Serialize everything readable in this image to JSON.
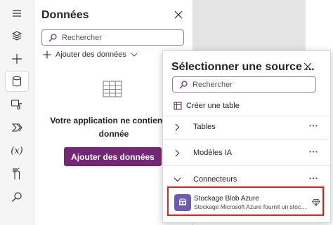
{
  "rail": {
    "items": [
      {
        "name": "hamburger-icon"
      },
      {
        "name": "layers-icon"
      },
      {
        "name": "plus-icon"
      },
      {
        "name": "database-icon",
        "active": true
      },
      {
        "name": "media-icon"
      },
      {
        "name": "power-automate-icon"
      },
      {
        "name": "variables-icon",
        "label": "(x)"
      },
      {
        "name": "tools-icon"
      },
      {
        "name": "search-icon"
      }
    ]
  },
  "data_pane": {
    "title": "Données",
    "search_placeholder": "Rechercher",
    "add_data_link": "Ajouter des données",
    "empty_message_line1": "Votre application ne contient au",
    "empty_message_line2": "donnée",
    "add_data_button": "Ajouter des données"
  },
  "flyout": {
    "title": "Sélectionner une source ...",
    "search_placeholder": "Rechercher",
    "create_table": "Créer une table",
    "sections": [
      {
        "label": "Tables",
        "expanded": false
      },
      {
        "label": "Modèles IA",
        "expanded": false
      },
      {
        "label": "Connecteurs",
        "expanded": true
      }
    ],
    "more_label": "...",
    "connector": {
      "name": "Stockage Blob Azure",
      "description": "Stockage Microsoft Azure fournit un stock..."
    }
  },
  "colors": {
    "accent": "#742774",
    "highlight": "#e02020",
    "connector_logo": "#6b5bb5"
  }
}
